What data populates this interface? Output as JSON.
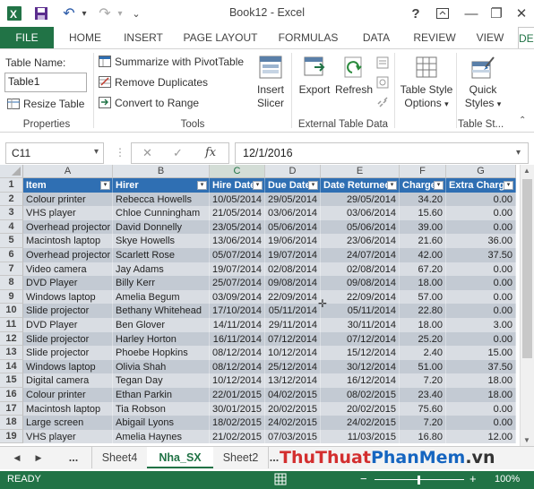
{
  "window": {
    "title": "Book12 - Excel",
    "help": "?",
    "minimize": "—",
    "restore": "❐",
    "close": "✕"
  },
  "qat": {
    "undo": "↶",
    "redo": "↷",
    "more": "⌄"
  },
  "tabs": [
    {
      "label": "FILE"
    },
    {
      "label": "HOME"
    },
    {
      "label": "INSERT"
    },
    {
      "label": "PAGE LAYOUT"
    },
    {
      "label": "FORMULAS"
    },
    {
      "label": "DATA"
    },
    {
      "label": "REVIEW"
    },
    {
      "label": "VIEW"
    },
    {
      "label": "DESIGN"
    }
  ],
  "ribbon": {
    "properties": {
      "label": "Properties",
      "table_name_label": "Table Name:",
      "table_name_value": "Table1",
      "resize_label": "Resize Table"
    },
    "tools": {
      "label": "Tools",
      "pivot": "Summarize with PivotTable",
      "dupes": "Remove Duplicates",
      "convert": "Convert to Range",
      "slicer1": "Insert",
      "slicer2": "Slicer"
    },
    "external": {
      "label": "External Table Data",
      "export": "Export",
      "refresh": "Refresh"
    },
    "style_options": {
      "line1": "Table Style",
      "line2": "Options"
    },
    "styles": {
      "label": "Table St...",
      "line1": "Quick",
      "line2": "Styles"
    }
  },
  "formula_bar": {
    "name_box": "C11",
    "cancel": "✕",
    "confirm": "✓",
    "fx": "fx",
    "content": "12/1/2016"
  },
  "columns": [
    "A",
    "B",
    "C",
    "D",
    "E",
    "F",
    "G"
  ],
  "headers": [
    "Item",
    "Hirer",
    "Hire Date",
    "Due Date",
    "Date Returned",
    "Charge",
    "Extra Charge"
  ],
  "rows": [
    {
      "n": "2",
      "c": [
        "Colour printer",
        "Rebecca Howells",
        "10/05/2014",
        "29/05/2014",
        "29/05/2014",
        "34.20",
        "0.00"
      ]
    },
    {
      "n": "3",
      "c": [
        "VHS player",
        "Chloe Cunningham",
        "21/05/2014",
        "03/06/2014",
        "03/06/2014",
        "15.60",
        "0.00"
      ]
    },
    {
      "n": "4",
      "c": [
        "Overhead projector",
        "David Donnelly",
        "23/05/2014",
        "05/06/2014",
        "05/06/2014",
        "39.00",
        "0.00"
      ]
    },
    {
      "n": "5",
      "c": [
        "Macintosh laptop",
        "Skye Howells",
        "13/06/2014",
        "19/06/2014",
        "23/06/2014",
        "21.60",
        "36.00"
      ]
    },
    {
      "n": "6",
      "c": [
        "Overhead projector",
        "Scarlett Rose",
        "05/07/2014",
        "19/07/2014",
        "24/07/2014",
        "42.00",
        "37.50"
      ]
    },
    {
      "n": "7",
      "c": [
        "Video camera",
        "Jay Adams",
        "19/07/2014",
        "02/08/2014",
        "02/08/2014",
        "67.20",
        "0.00"
      ]
    },
    {
      "n": "8",
      "c": [
        "DVD Player",
        "Billy Kerr",
        "25/07/2014",
        "09/08/2014",
        "09/08/2014",
        "18.00",
        "0.00"
      ]
    },
    {
      "n": "9",
      "c": [
        "Windows laptop",
        "Amelia Begum",
        "03/09/2014",
        "22/09/2014",
        "22/09/2014",
        "57.00",
        "0.00"
      ]
    },
    {
      "n": "10",
      "c": [
        "Slide projector",
        "Bethany Whitehead",
        "17/10/2014",
        "05/11/2014",
        "05/11/2014",
        "22.80",
        "0.00"
      ]
    },
    {
      "n": "11",
      "c": [
        "DVD Player",
        "Ben Glover",
        "14/11/2014",
        "29/11/2014",
        "30/11/2014",
        "18.00",
        "3.00"
      ]
    },
    {
      "n": "12",
      "c": [
        "Slide projector",
        "Harley Horton",
        "16/11/2014",
        "07/12/2014",
        "07/12/2014",
        "25.20",
        "0.00"
      ]
    },
    {
      "n": "13",
      "c": [
        "Slide projector",
        "Phoebe Hopkins",
        "08/12/2014",
        "10/12/2014",
        "15/12/2014",
        "2.40",
        "15.00"
      ]
    },
    {
      "n": "14",
      "c": [
        "Windows laptop",
        "Olivia Shah",
        "08/12/2014",
        "25/12/2014",
        "30/12/2014",
        "51.00",
        "37.50"
      ]
    },
    {
      "n": "15",
      "c": [
        "Digital camera",
        "Tegan Day",
        "10/12/2014",
        "13/12/2014",
        "16/12/2014",
        "7.20",
        "18.00"
      ]
    },
    {
      "n": "16",
      "c": [
        "Colour printer",
        "Ethan Parkin",
        "22/01/2015",
        "04/02/2015",
        "08/02/2015",
        "23.40",
        "18.00"
      ]
    },
    {
      "n": "17",
      "c": [
        "Macintosh laptop",
        "Tia Robson",
        "30/01/2015",
        "20/02/2015",
        "20/02/2015",
        "75.60",
        "0.00"
      ]
    },
    {
      "n": "18",
      "c": [
        "Large screen",
        "Abigail Lyons",
        "18/02/2015",
        "24/02/2015",
        "24/02/2015",
        "7.20",
        "0.00"
      ]
    },
    {
      "n": "19",
      "c": [
        "VHS player",
        "Amelia Haynes",
        "21/02/2015",
        "07/03/2015",
        "11/03/2015",
        "16.80",
        "12.00"
      ]
    }
  ],
  "header_row_num": "1",
  "sheets": {
    "prev": "◀",
    "next": "▶",
    "ellipsis": "...",
    "tabs": [
      "Sheet4",
      "Nha_SX",
      "Sheet2"
    ],
    "trail": "..."
  },
  "status": {
    "ready": "READY",
    "zoom": "100%",
    "minus": "−",
    "plus": "+"
  },
  "watermark": {
    "p1": "Thu",
    "p2": "Thuat",
    "p3": "Phan",
    "p4": "Mem",
    "p5": ".vn"
  },
  "colors": {
    "excel_green": "#217346",
    "table_header": "#2f6fb3",
    "band1": "#c3cad3",
    "band2": "#d9dde3"
  }
}
